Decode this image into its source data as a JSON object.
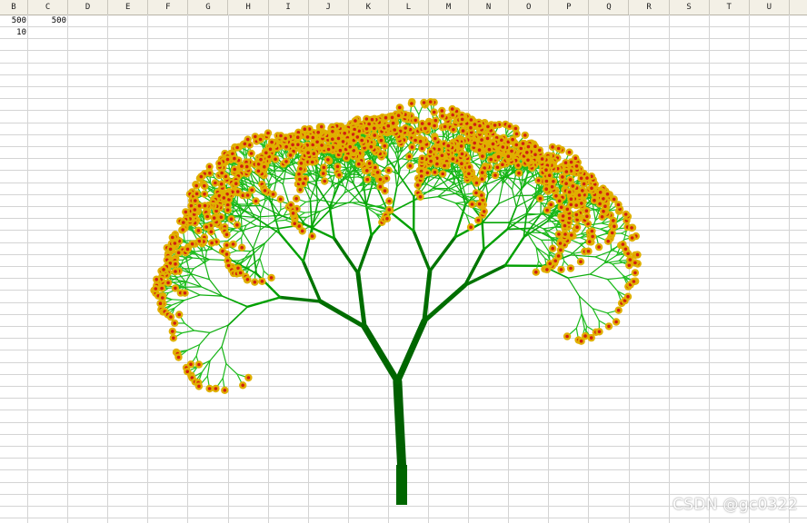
{
  "sheet": {
    "columns": [
      "B",
      "C",
      "D",
      "E",
      "F",
      "G",
      "H",
      "I",
      "J",
      "K",
      "L",
      "M",
      "N",
      "O",
      "P",
      "Q",
      "R",
      "S",
      "T",
      "U"
    ],
    "cells": {
      "B1": "500",
      "C1": "500",
      "B2": "10"
    }
  },
  "drawing": {
    "trunk_color": "#006600",
    "branch_color": "#00a000",
    "twig_color": "#22c022",
    "flower_outer_color": "#e0b000",
    "flower_inner_color": "#d02010"
  },
  "watermark": "CSDN @gc0322"
}
